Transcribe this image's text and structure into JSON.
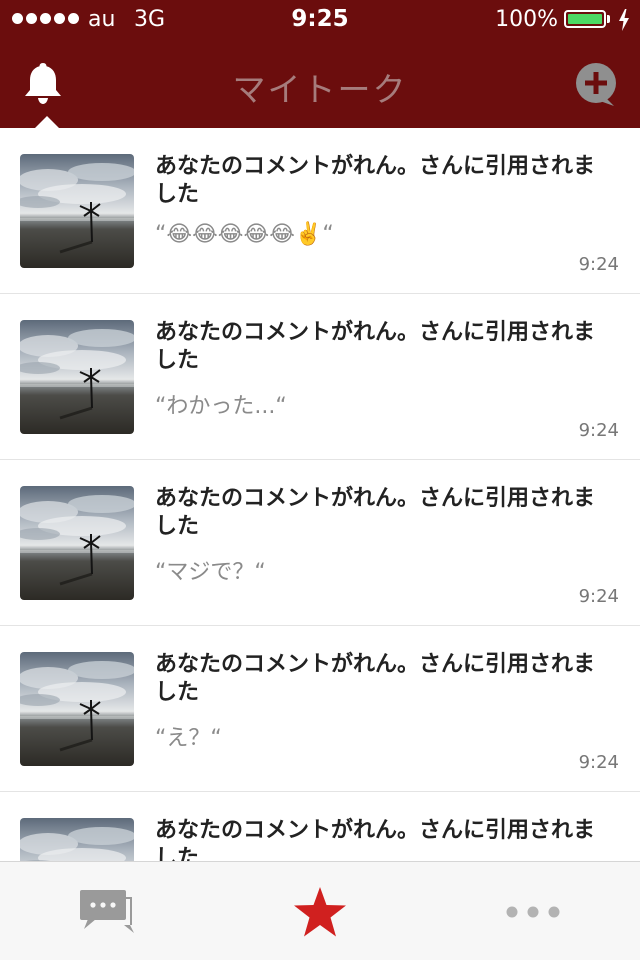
{
  "status_bar": {
    "carrier": "au",
    "network": "3G",
    "time": "9:25",
    "battery": "100%"
  },
  "header": {
    "title": "マイトーク",
    "left_icon": "bell-icon",
    "right_icon": "add-comment-icon"
  },
  "notifications": [
    {
      "title": "あなたのコメントがれん。さんに引用されました",
      "quote": "“😂😂😂😂😂✌️“",
      "time": "9:24"
    },
    {
      "title": "あなたのコメントがれん。さんに引用されました",
      "quote": "“わかった...“",
      "time": "9:24"
    },
    {
      "title": "あなたのコメントがれん。さんに引用されました",
      "quote": "“マジで？“",
      "time": "9:24"
    },
    {
      "title": "あなたのコメントがれん。さんに引用されました",
      "quote": "“え？“",
      "time": "9:24"
    },
    {
      "title": "あなたのコメントがれん。さんに引用されました",
      "quote": "",
      "time": ""
    }
  ],
  "tabbar": {
    "items": [
      "chat-bubbles-icon",
      "star-icon",
      "more-icon"
    ],
    "active": "star-icon"
  },
  "colors": {
    "header": "#6b0d0d",
    "accent": "#d0201f",
    "battery": "#4cd964"
  }
}
